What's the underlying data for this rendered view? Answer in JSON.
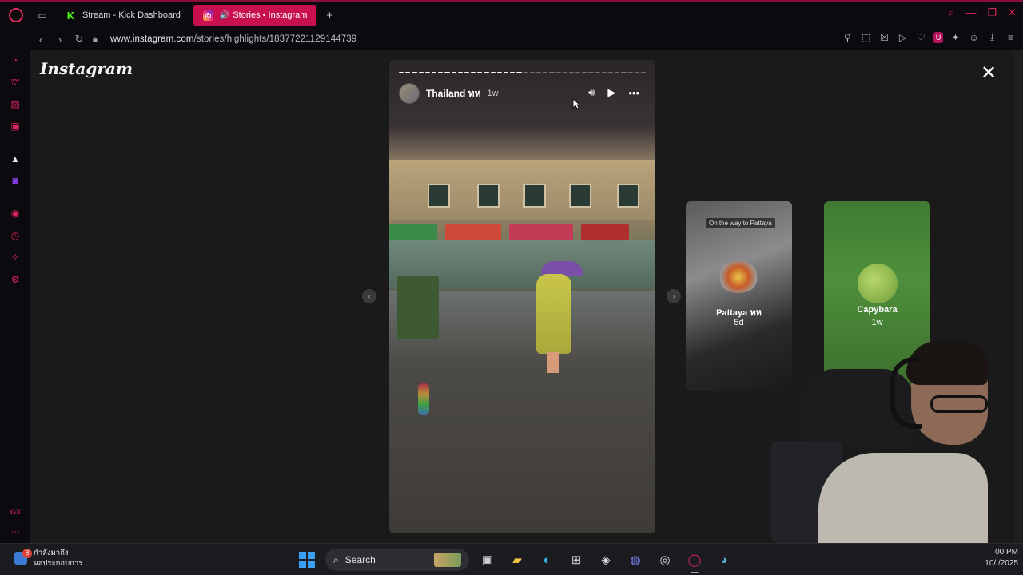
{
  "browser": {
    "tabs": [
      {
        "label": "Stream - Kick Dashboard",
        "active": false
      },
      {
        "label": "Stories • Instagram",
        "active": true
      }
    ],
    "url_host": "www.instagram.com",
    "url_path": "/stories/highlights/18377221129144739"
  },
  "instagram": {
    "logo_text": "Instagram",
    "story": {
      "title": "Thailand ทห",
      "time": "1w",
      "segments_total": 38,
      "segments_done": 19
    },
    "highlights": [
      {
        "name": "Pattaya ทห",
        "time": "5d",
        "tag": "On the way to Pattaya"
      },
      {
        "name": "Capybara",
        "time": "1w",
        "tag": ""
      }
    ]
  },
  "taskbar": {
    "weather_line1": "กำลังมาถึง",
    "weather_line2": "ผลประกอบการ",
    "weather_badge": "8",
    "search_label": "Search",
    "clock_time": "00 PM",
    "clock_date": "10/ /2025"
  },
  "colors": {
    "accent": "#e0245e",
    "active_tab": "#c8104f",
    "page_bg": "#1a1a1a"
  }
}
